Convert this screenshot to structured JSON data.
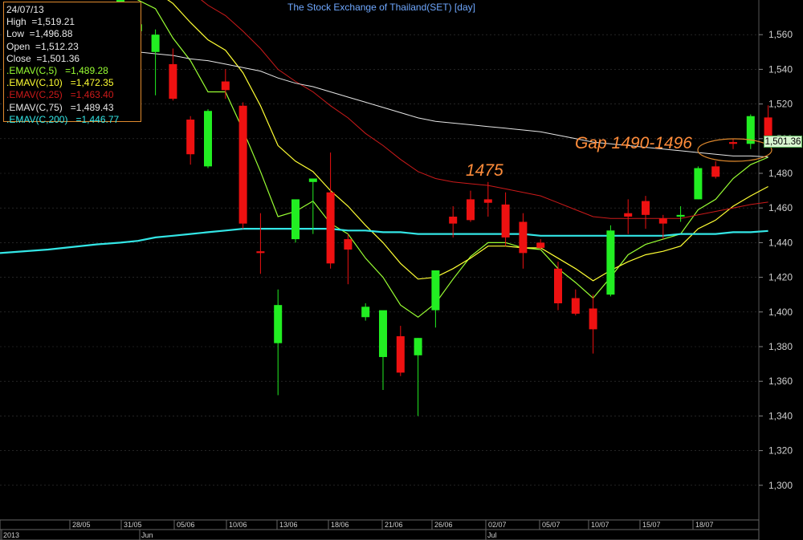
{
  "title": "The Stock Exchange of Thailand(SET) [day]",
  "info": {
    "date": "24/07/13",
    "high": "High  =1,519.21",
    "low": "Low  =1,496.88",
    "open": "Open  =1,512.23",
    "close": "Close  =1,501.36",
    "ema5": ".EMAV(C,5)   =1,489.28",
    "ema10": ".EMAV(C,10)   =1,472.35",
    "ema25": ".EMAV(C,25)   =1,463.40",
    "ema75": ".EMAV(C,75)   =1,489.43",
    "ema200": ".EMAV(C,200)   =1,446.77"
  },
  "last_price_label": "1,501.36",
  "annotations": {
    "gap": "Gap 1490-1496",
    "level": "1475"
  },
  "colors": {
    "up": "#22ee22",
    "down": "#ee1111",
    "ema5": "#99ff33",
    "ema10": "#ffff33",
    "ema25": "#cc1a1a",
    "ema75": "#e6e6e6",
    "ema200": "#33e6e6",
    "annotation": "#ff8c3a",
    "grid": "#3a3a3a",
    "title": "#6fa8ff"
  },
  "chart_data": {
    "type": "candlestick",
    "ylim": [
      1280,
      1580
    ],
    "y_ticks": [
      "1,300",
      "1,320",
      "1,340",
      "1,360",
      "1,380",
      "1,400",
      "1,420",
      "1,440",
      "1,460",
      "1,480",
      "1,500",
      "1,520",
      "1,540",
      "1,560"
    ],
    "x_date_ticks": [
      "28/05",
      "31/05",
      "05/06",
      "10/06",
      "13/06",
      "18/06",
      "21/06",
      "26/06",
      "02/07",
      "05/07",
      "10/07",
      "15/07",
      "18/07"
    ],
    "x_lower_labels": [
      "2013",
      "Jun",
      "Jul"
    ],
    "candles": [
      {
        "o": 1568,
        "h": 1580,
        "l": 1560,
        "c": 1580
      },
      {
        "o": 1562,
        "h": 1570,
        "l": 1550,
        "c": 1566
      },
      {
        "o": 1550,
        "h": 1563,
        "l": 1525,
        "c": 1560
      },
      {
        "o": 1543,
        "h": 1552,
        "l": 1522,
        "c": 1523
      },
      {
        "o": 1511,
        "h": 1513,
        "l": 1485,
        "c": 1491
      },
      {
        "o": 1484,
        "h": 1517,
        "l": 1483,
        "c": 1516
      },
      {
        "o": 1533,
        "h": 1540,
        "l": 1523,
        "c": 1528
      },
      {
        "o": 1519,
        "h": 1521,
        "l": 1448,
        "c": 1451
      },
      {
        "o": 1435,
        "h": 1457,
        "l": 1422,
        "c": 1434
      },
      {
        "o": 1382,
        "h": 1413,
        "l": 1352,
        "c": 1404
      },
      {
        "o": 1442,
        "h": 1464,
        "l": 1440,
        "c": 1465
      },
      {
        "o": 1475,
        "h": 1477,
        "l": 1445,
        "c": 1477
      },
      {
        "o": 1469,
        "h": 1492,
        "l": 1425,
        "c": 1428
      },
      {
        "o": 1442,
        "h": 1445,
        "l": 1416,
        "c": 1436
      },
      {
        "o": 1397,
        "h": 1405,
        "l": 1395,
        "c": 1403
      },
      {
        "o": 1374,
        "h": 1400,
        "l": 1355,
        "c": 1401
      },
      {
        "o": 1386,
        "h": 1392,
        "l": 1363,
        "c": 1365
      },
      {
        "o": 1375,
        "h": 1385,
        "l": 1340,
        "c": 1385
      },
      {
        "o": 1401,
        "h": 1423,
        "l": 1391,
        "c": 1424
      },
      {
        "o": 1455,
        "h": 1461,
        "l": 1443,
        "c": 1451
      },
      {
        "o": 1465,
        "h": 1470,
        "l": 1452,
        "c": 1453
      },
      {
        "o": 1465,
        "h": 1475,
        "l": 1455,
        "c": 1463
      },
      {
        "o": 1462,
        "h": 1469,
        "l": 1438,
        "c": 1443
      },
      {
        "o": 1452,
        "h": 1457,
        "l": 1425,
        "c": 1434
      },
      {
        "o": 1440,
        "h": 1442,
        "l": 1436,
        "c": 1437
      },
      {
        "o": 1425,
        "h": 1429,
        "l": 1401,
        "c": 1405
      },
      {
        "o": 1408,
        "h": 1413,
        "l": 1398,
        "c": 1399
      },
      {
        "o": 1402,
        "h": 1410,
        "l": 1376,
        "c": 1390
      },
      {
        "o": 1410,
        "h": 1450,
        "l": 1409,
        "c": 1447
      },
      {
        "o": 1457,
        "h": 1465,
        "l": 1445,
        "c": 1455
      },
      {
        "o": 1464,
        "h": 1467,
        "l": 1448,
        "c": 1456
      },
      {
        "o": 1454,
        "h": 1456,
        "l": 1442,
        "c": 1451
      },
      {
        "o": 1455,
        "h": 1461,
        "l": 1452,
        "c": 1456
      },
      {
        "o": 1465,
        "h": 1484,
        "l": 1465,
        "c": 1483
      },
      {
        "o": 1484,
        "h": 1487,
        "l": 1477,
        "c": 1478
      },
      {
        "o": 1498,
        "h": 1500,
        "l": 1494,
        "c": 1497
      },
      {
        "o": 1497,
        "h": 1514,
        "l": 1494,
        "c": 1513
      },
      {
        "o": 1512.23,
        "h": 1519.21,
        "l": 1496.88,
        "c": 1501.36
      }
    ],
    "series": [
      {
        "name": ".EMAV(C,5)",
        "values": [
          1590,
          1580,
          1575,
          1558,
          1545,
          1527,
          1527,
          1505,
          1481,
          1455,
          1458,
          1464,
          1451,
          1445,
          1431,
          1420,
          1404,
          1397,
          1405,
          1419,
          1432,
          1440,
          1440,
          1437,
          1436,
          1425,
          1417,
          1408,
          1420,
          1433,
          1439,
          1442,
          1445,
          1459,
          1465,
          1477,
          1485,
          1489.28
        ]
      },
      {
        "name": ".EMAV(C,10)",
        "values": [
          1600,
          1595,
          1585,
          1578,
          1567,
          1557,
          1551,
          1538,
          1519,
          1496,
          1487,
          1481,
          1470,
          1461,
          1450,
          1440,
          1428,
          1419,
          1420,
          1425,
          1431,
          1438,
          1438,
          1437,
          1437,
          1431,
          1425,
          1418,
          1424,
          1429,
          1433,
          1435,
          1438,
          1448,
          1453,
          1461,
          1467,
          1472.35
        ]
      },
      {
        "name": ".EMAV(C,25)",
        "values": [
          1610,
          1605,
          1598,
          1592,
          1585,
          1577,
          1571,
          1562,
          1552,
          1540,
          1533,
          1527,
          1519,
          1512,
          1503,
          1496,
          1488,
          1481,
          1477,
          1475,
          1474,
          1473,
          1471,
          1469,
          1467,
          1463,
          1459,
          1455,
          1454,
          1454,
          1454,
          1454,
          1454,
          1456,
          1458,
          1460,
          1462,
          1463.4
        ]
      },
      {
        "name": ".EMAV(C,75)",
        "values": [
          1550,
          1550,
          1549,
          1548,
          1546,
          1545,
          1543,
          1541,
          1539,
          1535,
          1532,
          1530,
          1527,
          1524,
          1521,
          1518,
          1515,
          1512,
          1510,
          1509,
          1508,
          1507,
          1506,
          1505,
          1504,
          1502,
          1500,
          1498,
          1497,
          1496,
          1495,
          1494,
          1493,
          1492,
          1491,
          1490,
          1490,
          1489.43
        ]
      },
      {
        "name": ".EMAV(C,200)",
        "values": [
          1440,
          1441,
          1443,
          1444,
          1445,
          1446,
          1447,
          1448,
          1448,
          1448,
          1448,
          1448,
          1448,
          1447,
          1447,
          1446,
          1446,
          1445,
          1445,
          1445,
          1445,
          1445,
          1445,
          1445,
          1444,
          1444,
          1444,
          1444,
          1444,
          1444,
          1444,
          1444,
          1445,
          1445,
          1445,
          1446,
          1446,
          1446.77
        ]
      }
    ]
  }
}
